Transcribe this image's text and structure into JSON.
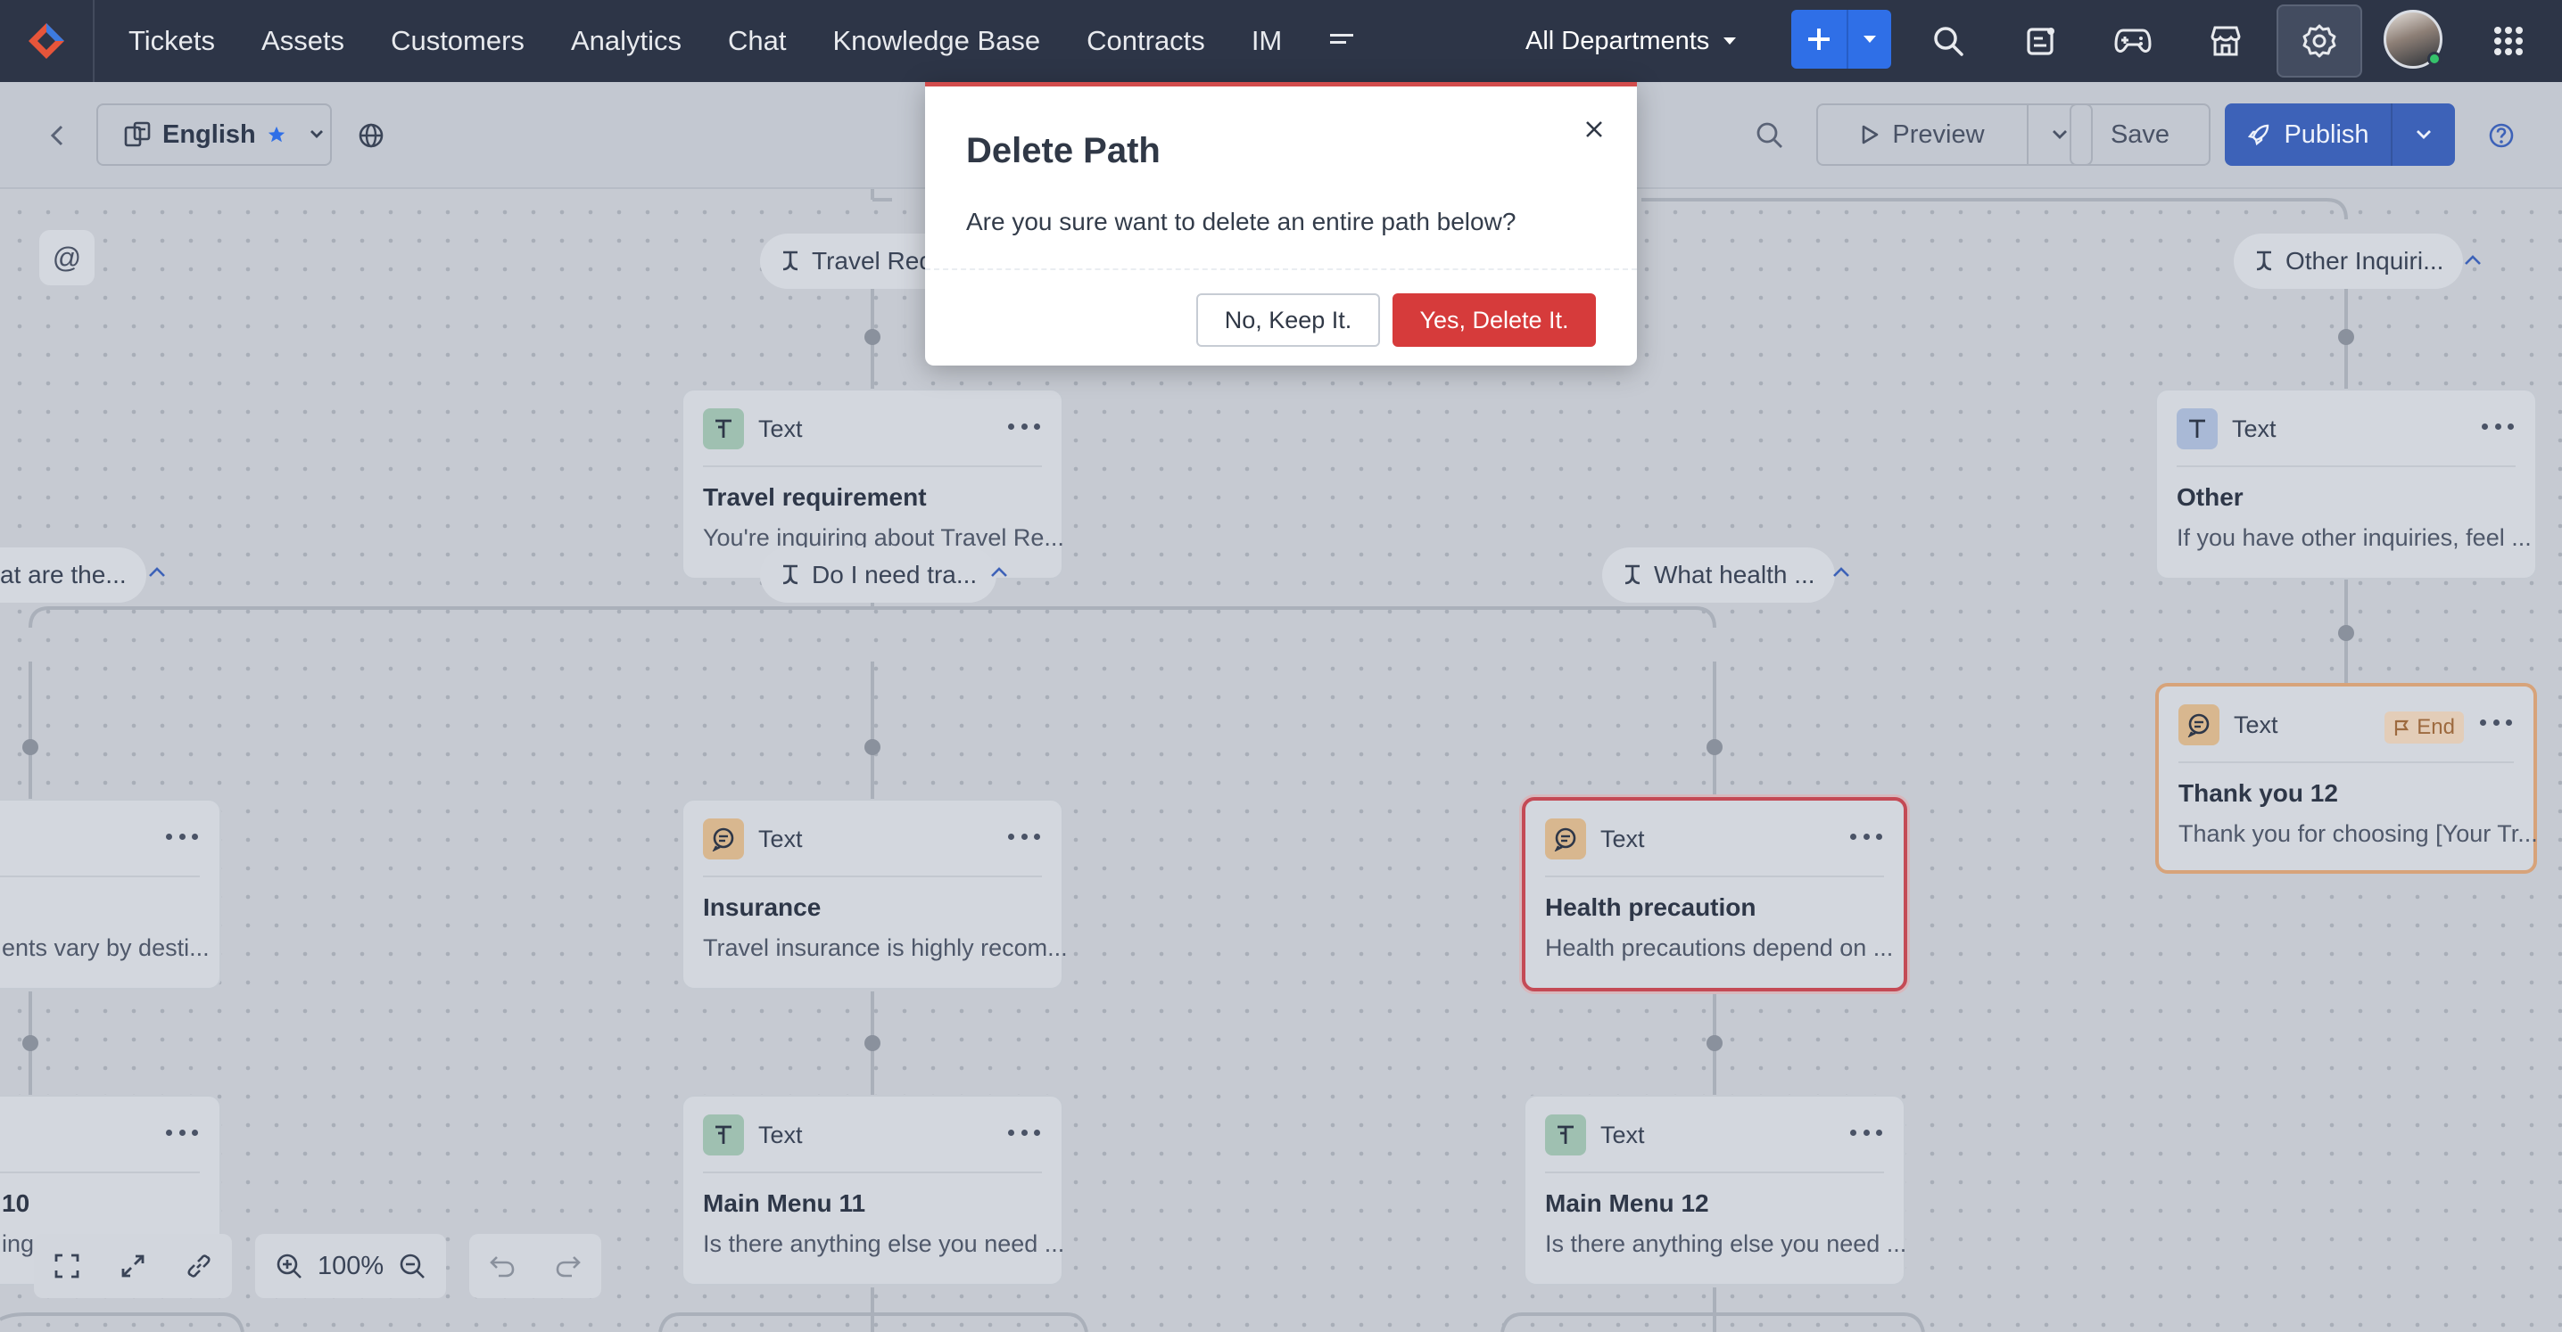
{
  "nav": {
    "items": [
      "Tickets",
      "Assets",
      "Customers",
      "Analytics",
      "Chat",
      "Knowledge Base",
      "Contracts",
      "IM"
    ],
    "department": "All Departments",
    "icons": [
      "search-icon",
      "feed-icon",
      "game-controller-icon",
      "marketplace-icon",
      "settings-icon",
      "apps-grid-icon"
    ],
    "accent": "#2f6fe7",
    "status_online": "#35c36b"
  },
  "toolbar": {
    "language": "English",
    "preview_label": "Preview",
    "save_label": "Save",
    "publish_label": "Publish"
  },
  "canvas": {
    "chips": {
      "travel": "Travel Req",
      "other": "Other Inquiri...",
      "what_are": "at are the...",
      "do_i_need": "Do I need tra...",
      "what_health": "What health ..."
    },
    "nodes": {
      "travel_requirement": {
        "type": "Text",
        "title": "Travel requirement",
        "subtitle": "You're inquiring about Travel Re..."
      },
      "other": {
        "type": "Text",
        "title": "Other",
        "subtitle": "If you have other inquiries, feel ..."
      },
      "thank_you": {
        "type": "Text",
        "badge": "End",
        "title": "Thank you 12",
        "subtitle": "Thank you for choosing [Your Tr..."
      },
      "left_partial": {
        "subtitle": "ents vary by desti..."
      },
      "insurance": {
        "type": "Text",
        "title": "Insurance",
        "subtitle": "Travel insurance is highly recom..."
      },
      "health": {
        "type": "Text",
        "title": "Health precaution",
        "subtitle": "Health precautions depend on ..."
      },
      "left_bottom_partial": {
        "title": "10",
        "subtitle": "ing"
      },
      "main_menu_11": {
        "type": "Text",
        "title": "Main Menu 11",
        "subtitle": "Is there anything else you need ..."
      },
      "main_menu_12": {
        "type": "Text",
        "title": "Main Menu 12",
        "subtitle": "Is there anything else you need ..."
      }
    },
    "zoom": "100%",
    "delete_color": "#c44a55"
  },
  "modal": {
    "title": "Delete Path",
    "message": "Are you sure want to delete an entire path below?",
    "keep_label": "No, Keep It.",
    "delete_label": "Yes, Delete It.",
    "danger_color": "#d63b3b"
  }
}
